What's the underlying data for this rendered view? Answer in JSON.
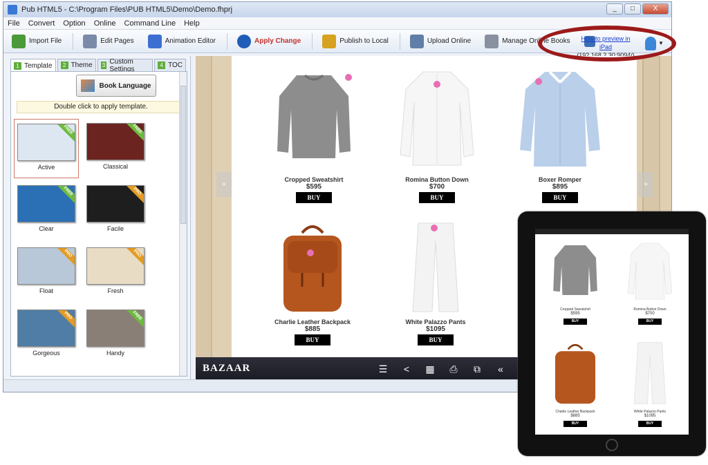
{
  "window": {
    "title": "Pub HTML5 - C:\\Program Files\\PUB HTML5\\Demo\\Demo.fhprj",
    "controls": [
      "_",
      "□",
      "X"
    ]
  },
  "menu": [
    "File",
    "Convert",
    "Option",
    "Online",
    "Command Line",
    "Help"
  ],
  "toolbar": {
    "items": [
      {
        "label": "Import File",
        "icon": "import-file-icon",
        "color": "#4a9a3a"
      },
      {
        "label": "Edit Pages",
        "icon": "edit-pages-icon",
        "color": "#7a8aa8"
      },
      {
        "label": "Animation Editor",
        "icon": "animation-editor-icon",
        "color": "#3c6fd1"
      },
      {
        "label": "Apply Change",
        "icon": "apply-change-icon",
        "color": "#1f5db8"
      },
      {
        "label": "Publish to Local",
        "icon": "publish-local-icon",
        "color": "#d6a21f"
      },
      {
        "label": "Upload Online",
        "icon": "upload-online-icon",
        "color": "#5f7fa6"
      },
      {
        "label": "Manage Online Books",
        "icon": "manage-books-icon",
        "color": "#8891a0"
      }
    ],
    "preview_link": "How to preview in iPad",
    "preview_address": "(192.168.2.30:9094/)"
  },
  "left_panel": {
    "tabs": [
      {
        "num": "1",
        "label": "Template"
      },
      {
        "num": "2",
        "label": "Theme"
      },
      {
        "num": "3",
        "label": "Custom Settings"
      },
      {
        "num": "4",
        "label": "TOC"
      }
    ],
    "book_language_button": "Book Language",
    "hint": "Double click to apply template.",
    "templates": [
      {
        "name": "Active",
        "badge": "FREE",
        "badge_color": "#6dbb3f",
        "bg": "#dde7f2"
      },
      {
        "name": "Classical",
        "badge": "FREE",
        "badge_color": "#6dbb3f",
        "bg": "#6b2420"
      },
      {
        "name": "Clear",
        "badge": "FREE",
        "badge_color": "#6dbb3f",
        "bg": "#2b6fb4"
      },
      {
        "name": "Facile",
        "badge": "PRO",
        "badge_color": "#e39b23",
        "bg": "#1e1e1e"
      },
      {
        "name": "Float",
        "badge": "PRO",
        "badge_color": "#e39b23",
        "bg": "#b8c8d8"
      },
      {
        "name": "Fresh",
        "badge": "PRO",
        "badge_color": "#e39b23",
        "bg": "#e9dcc4"
      },
      {
        "name": "Gorgeous",
        "badge": "PRO",
        "badge_color": "#e39b23",
        "bg": "#4f7da5"
      },
      {
        "name": "Handy",
        "badge": "FREE",
        "badge_color": "#6dbb3f",
        "bg": "#8a7f76"
      }
    ]
  },
  "book": {
    "brand": "BAZAAR",
    "products": [
      {
        "name": "Cropped Sweatshirt",
        "price": "$595",
        "buy": "BUY",
        "color": "#8d8d8d"
      },
      {
        "name": "Romina Button Down",
        "price": "$700",
        "buy": "BUY",
        "color": "#f6f6f6"
      },
      {
        "name": "Boxer Romper",
        "price": "$895",
        "buy": "BUY",
        "color": "#b9cfea"
      },
      {
        "name": "Charlie Leather Backpack",
        "price": "$885",
        "buy": "BUY",
        "color": "#b5561f"
      },
      {
        "name": "White Palazzo Pants",
        "price": "$1095",
        "buy": "BUY",
        "color": "#f3f3f3"
      }
    ],
    "bottom_icons": [
      "list-icon",
      "share-icon",
      "grid-icon",
      "print-icon",
      "fullscreen-icon",
      "prev-page-icon"
    ]
  },
  "ipad": {
    "products": [
      {
        "name": "Cropped Sweatshirt",
        "price": "$595",
        "buy": "BUY"
      },
      {
        "name": "Romina Button Down",
        "price": "$700",
        "buy": "BUY"
      },
      {
        "name": "Charlie Leather Backpack",
        "price": "$885",
        "buy": "BUY"
      },
      {
        "name": "White Palazzo Pants",
        "price": "$1095",
        "buy": "BUY"
      }
    ]
  }
}
